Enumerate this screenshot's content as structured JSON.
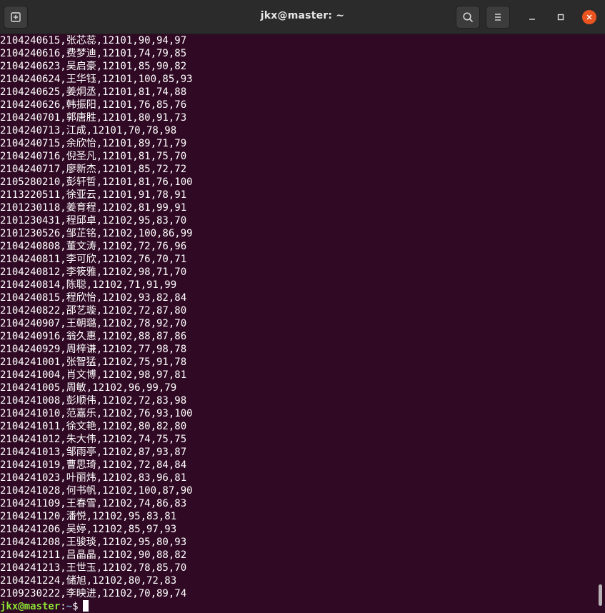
{
  "window": {
    "title": "jkx@master: ~"
  },
  "icons": {
    "new_tab": "new-tab-icon",
    "search": "search-icon",
    "menu": "hamburger-menu-icon",
    "minimize": "minimize-icon",
    "maximize": "maximize-icon",
    "close": "close-icon"
  },
  "colors": {
    "terminal_bg": "#300a24",
    "titlebar_bg": "#2b2b2b",
    "text": "#ffffff",
    "prompt_user": "#8ae234",
    "prompt_path": "#729fcf",
    "close_button": "#e95420"
  },
  "terminal": {
    "lines": [
      "2104240615,张芯蕊,12101,90,94,97",
      "2104240616,费梦迪,12101,74,79,85",
      "2104240623,吴启豪,12101,85,90,82",
      "2104240624,王华钰,12101,100,85,93",
      "2104240625,姜炯丞,12101,81,74,88",
      "2104240626,韩振阳,12101,76,85,76",
      "2104240701,郭唐胜,12101,80,91,73",
      "2104240713,江成,12101,70,78,98",
      "2104240715,余欣怡,12101,89,71,79",
      "2104240716,倪圣凡,12101,81,75,70",
      "2104240717,廖新杰,12101,85,72,72",
      "2105280210,彭轩哲,12101,81,76,100",
      "2113220511,徐亚云,12101,91,78,91",
      "2101230118,姜育程,12102,81,99,91",
      "2101230431,程邱卓,12102,95,83,70",
      "2101230526,邹芷铭,12102,100,86,99",
      "2104240808,董文涛,12102,72,76,96",
      "2104240811,李可欣,12102,76,70,71",
      "2104240812,李筱雅,12102,98,71,70",
      "2104240814,陈聪,12102,71,91,99",
      "2104240815,程欣怡,12102,93,82,84",
      "2104240822,邵艺璇,12102,72,87,80",
      "2104240907,王朝璐,12102,78,92,70",
      "2104240916,翁久惠,12102,88,87,86",
      "2104240929,周梓谦,12102,77,98,78",
      "2104241001,张智猛,12102,75,91,78",
      "2104241004,肖文博,12102,98,97,81",
      "2104241005,周敏,12102,96,99,79",
      "2104241008,彭顺伟,12102,72,83,98",
      "2104241010,范嘉乐,12102,76,93,100",
      "2104241011,徐文艳,12102,80,82,80",
      "2104241012,朱大伟,12102,74,75,75",
      "2104241013,邹雨亭,12102,87,93,87",
      "2104241019,曹思琦,12102,72,84,84",
      "2104241023,叶丽炜,12102,83,96,81",
      "2104241028,何书帆,12102,100,87,90",
      "2104241109,王春雪,12102,74,86,83",
      "2104241120,潘悦,12102,95,83,81",
      "2104241206,吴婷,12102,85,97,93",
      "2104241208,王骏琰,12102,95,80,93",
      "2104241211,吕晶晶,12102,90,88,82",
      "2104241213,王世玉,12102,78,85,70",
      "2104241224,储旭,12102,80,72,83",
      "2109230222,李映进,12102,70,89,74"
    ],
    "prompt": {
      "user": "jkx@master",
      "separator": ":",
      "path": "~",
      "symbol": "$"
    }
  }
}
